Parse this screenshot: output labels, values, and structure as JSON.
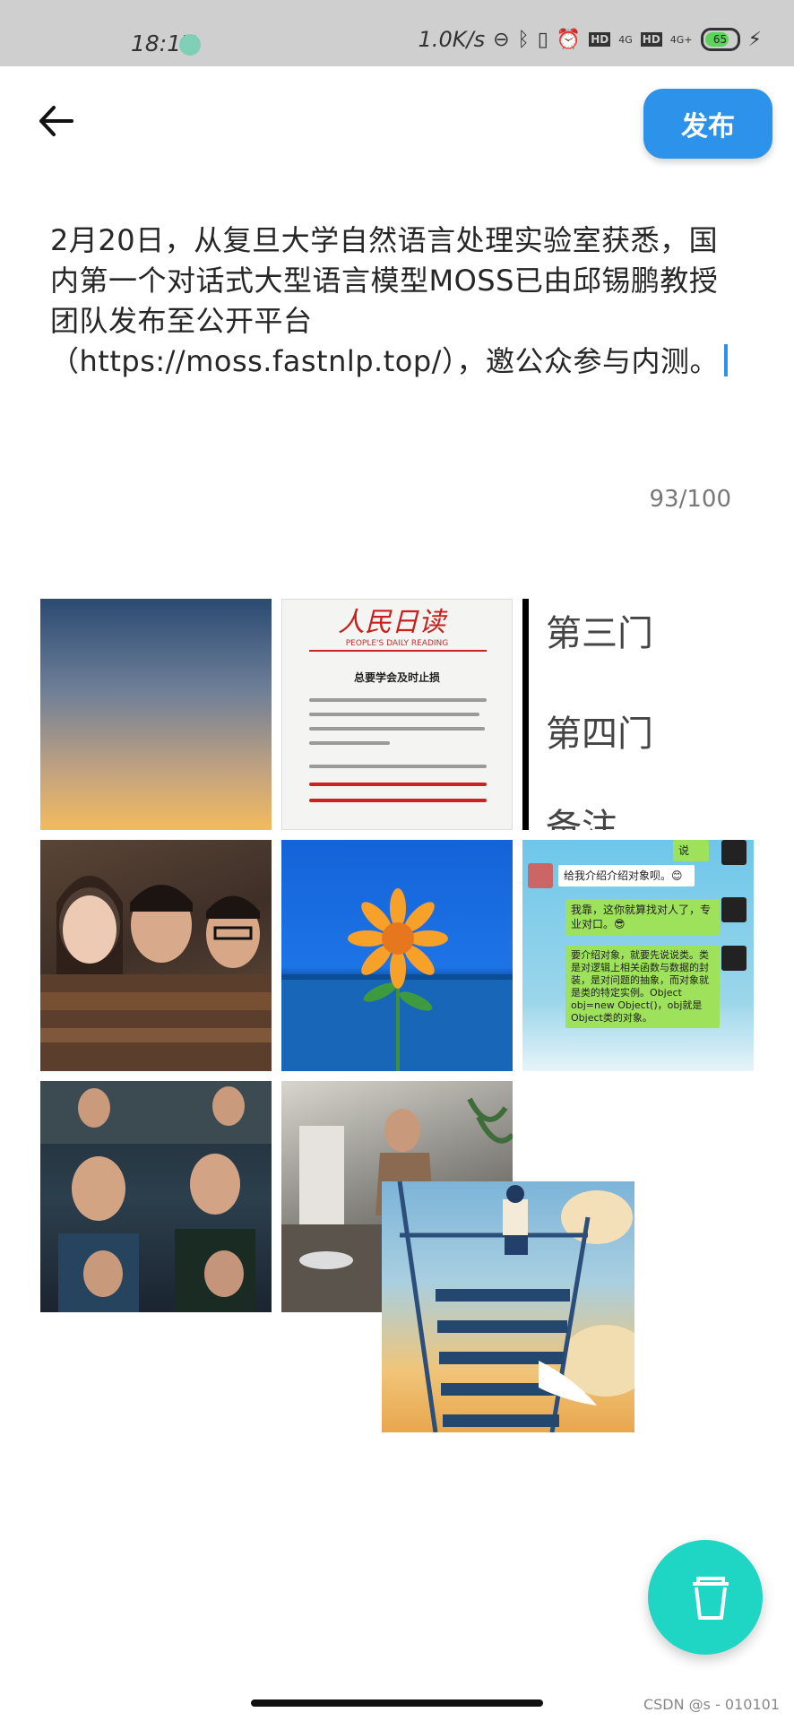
{
  "status_bar": {
    "time": "18:17",
    "network_speed": "1.0K/s",
    "sig1_label": "4G",
    "sig2_label": "4G+",
    "hd1": "HD",
    "hd2": "HD",
    "battery": "65"
  },
  "header": {
    "publish_label": "发布"
  },
  "post": {
    "text": "2月20日，从复旦大学自然语言处理实验室获悉，国内第一个对话式大型语言模型MOSS已由邱锡鹏教授团队发布至公开平台（https://moss.fastnlp.top/），邀公众参与内测。",
    "counter": "93/100"
  },
  "images": {
    "tile2": {
      "logo": "人民日读",
      "subtitle": "PEOPLE'S DAILY READING",
      "title": "总要学会及时止损"
    },
    "tile3": {
      "line1": "第三门",
      "line2": "第四门",
      "line3": "备注"
    },
    "tile6": {
      "top": "说",
      "m1": "给我介绍介绍对象呗。😊",
      "m2": "我靠，这你就算找对人了，专业对口。😎",
      "m3": "要介绍对象，就要先说说类。类是对逻辑上相关函数与数据的封装，是对问题的抽象，而对象就是类的特定实例。Object obj=new Object()，obj就是Object类的对象。"
    }
  },
  "watermark": "CSDN @s - 010101"
}
